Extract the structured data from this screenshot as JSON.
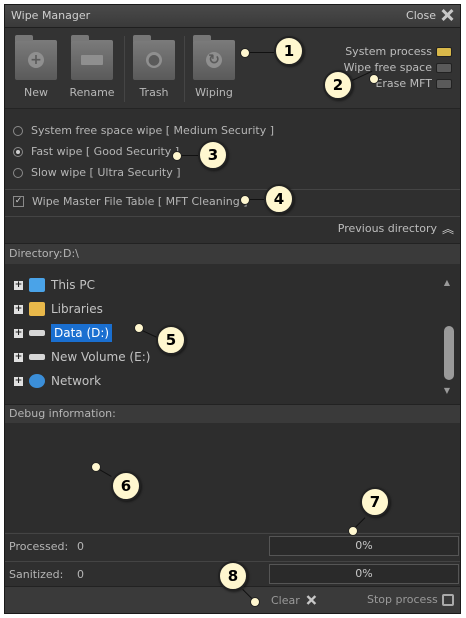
{
  "window": {
    "title": "Wipe Manager",
    "close_label": "Close"
  },
  "toolbar": {
    "buttons": [
      {
        "label": "New",
        "icon": "folder-plus-icon"
      },
      {
        "label": "Rename",
        "icon": "folder-rename-icon"
      },
      {
        "label": "Trash",
        "icon": "trash-folder-icon"
      },
      {
        "label": "Wiping",
        "icon": "wipe-folder-icon"
      }
    ],
    "options": [
      {
        "label": "System process",
        "active": true
      },
      {
        "label": "Wipe free space",
        "active": false
      },
      {
        "label": "Erase MFT",
        "active": false
      }
    ]
  },
  "wipe_modes": [
    {
      "label": "System free space wipe [ Medium Security ]",
      "selected": false
    },
    {
      "label": "Fast wipe [ Good Security ]",
      "selected": true
    },
    {
      "label": "Slow wipe [ Ultra Security ]",
      "selected": false
    }
  ],
  "mft_option": {
    "label": "Wipe Master File Table [ MFT Cleaning ]",
    "checked": true
  },
  "navigation": {
    "previous_label": "Previous directory"
  },
  "directory": {
    "label": "Directory:",
    "value": "D:\\"
  },
  "tree": [
    {
      "label": "This PC",
      "icon": "computer-icon",
      "selected": false
    },
    {
      "label": "Libraries",
      "icon": "library-folder-icon",
      "selected": false
    },
    {
      "label": "Data (D:)",
      "icon": "drive-icon",
      "selected": true
    },
    {
      "label": "New Volume (E:)",
      "icon": "drive-icon",
      "selected": false
    },
    {
      "label": "Network",
      "icon": "network-icon",
      "selected": false
    }
  ],
  "debug": {
    "label": "Debug information:"
  },
  "stats": {
    "processed": {
      "label": "Processed:",
      "value": "0",
      "progress_text": "0%",
      "progress": 0
    },
    "sanitized": {
      "label": "Sanitized:",
      "value": "0",
      "progress_text": "0%",
      "progress": 0
    }
  },
  "footer": {
    "clear_label": "Clear",
    "stop_label": "Stop process"
  },
  "callouts": [
    "1",
    "2",
    "3",
    "4",
    "5",
    "6",
    "7",
    "8"
  ],
  "colors": {
    "accent": "#d9b84a",
    "selection": "#1a6fd0",
    "callout_fill": "#fff7cf"
  }
}
